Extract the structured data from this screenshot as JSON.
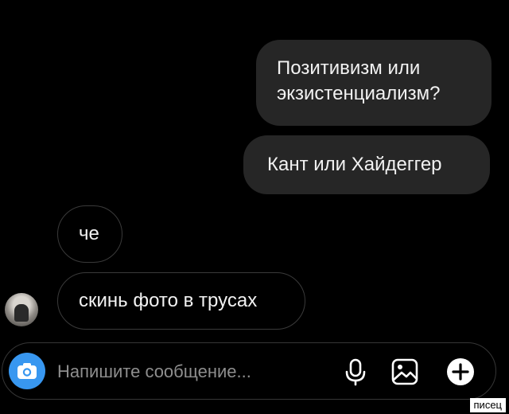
{
  "messages": [
    {
      "direction": "outgoing",
      "text": "Позитивизм или экзистенциализм?"
    },
    {
      "direction": "outgoing",
      "text": "Кант или Хайдеггер"
    },
    {
      "direction": "incoming",
      "text": "че"
    },
    {
      "direction": "incoming",
      "text": "скинь фото в трусах"
    }
  ],
  "composer": {
    "placeholder": "Напишите сообщение...",
    "icons": [
      "camera-icon",
      "microphone-icon",
      "gallery-icon",
      "plus-icon"
    ]
  },
  "watermark": "писец",
  "colors": {
    "background": "#000000",
    "outgoing_bubble": "#262626",
    "incoming_border": "#3a3a3a",
    "accent_camera": "#3897f0",
    "placeholder_text": "#8e8e8e"
  }
}
